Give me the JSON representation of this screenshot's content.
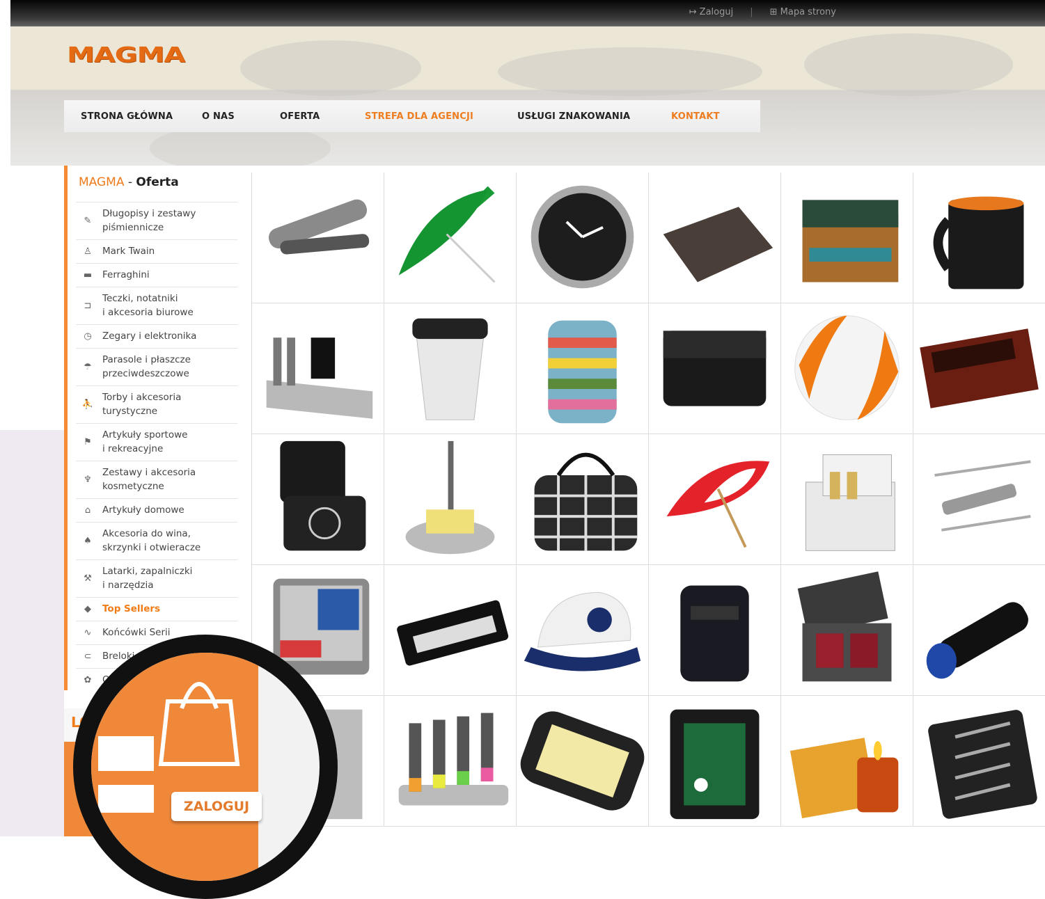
{
  "topbar": {
    "login_label": "Zaloguj",
    "sitemap_label": "Mapa strony"
  },
  "header": {
    "logo_text": "MAGMA"
  },
  "nav": {
    "items": [
      {
        "label": "STRONA GŁÓWNA",
        "active": false
      },
      {
        "label": "O NAS",
        "active": false
      },
      {
        "label": "OFERTA",
        "active": false
      },
      {
        "label": "STREFA DLA AGENCJI",
        "active": true
      },
      {
        "label": "USŁUGI ZNAKOWANIA",
        "active": false
      },
      {
        "label": "KONTAKT",
        "active": true
      }
    ]
  },
  "sidebar": {
    "title_brand": "MAGMA",
    "title_sep": " - ",
    "title_word": "Oferta",
    "items": [
      {
        "line1": "Długopisy i zestawy",
        "line2": "piśmiennicze",
        "icon": "pen-icon"
      },
      {
        "line1": "Mark Twain",
        "line2": "",
        "icon": "bust-icon"
      },
      {
        "line1": "Ferraghini",
        "line2": "",
        "icon": "briefcase-icon"
      },
      {
        "line1": "Teczki, notatniki",
        "line2": "i akcesoria biurowe",
        "icon": "folder-icon"
      },
      {
        "line1": "Zegary i elektronika",
        "line2": "",
        "icon": "clock-icon"
      },
      {
        "line1": "Parasole i płaszcze",
        "line2": "przeciwdeszczowe",
        "icon": "umbrella-icon"
      },
      {
        "line1": "Torby i akcesoria",
        "line2": "turystyczne",
        "icon": "hiker-icon"
      },
      {
        "line1": "Artykuły sportowe",
        "line2": "i rekreacyjne",
        "icon": "sport-icon"
      },
      {
        "line1": "Zestawy i akcesoria",
        "line2": "kosmetyczne",
        "icon": "cosmetics-icon"
      },
      {
        "line1": "Artykuły domowe",
        "line2": "",
        "icon": "home-icon"
      },
      {
        "line1": "Akcesoria do wina,",
        "line2": "skrzynki i otwieracze",
        "icon": "wine-icon"
      },
      {
        "line1": "Latarki, zapalniczki",
        "line2": "i narzędzia",
        "icon": "tools-icon"
      },
      {
        "line1": "Top Sellers",
        "line2": "",
        "icon": "top-sellers-icon",
        "highlight": true
      },
      {
        "line1": "Końcówki Serii",
        "line2": "",
        "icon": "end-of-series-icon"
      },
      {
        "line1": "Breloki",
        "line2": "",
        "icon": "keychain-icon"
      },
      {
        "line1": "O",
        "line2": "",
        "icon": "other-icon"
      }
    ]
  },
  "login_panel": {
    "title": "LO",
    "button_label": "ZALOGUJ"
  },
  "products": [
    [
      "pen-set",
      "green-umbrella",
      "wall-clock",
      "laptop-sleeve",
      "picnic-basket",
      "black-mug"
    ],
    [
      "desk-organizer",
      "travel-tumbler",
      "striped-backpack",
      "messenger-bag",
      "beach-ball",
      "wine-box"
    ],
    [
      "jewelry-box",
      "pen-stand",
      "plaid-bag",
      "red-white-umbrella",
      "gift-box",
      "multi-tool"
    ],
    [
      "trolley-case",
      "pen-case",
      "baseball-cap",
      "backpack",
      "gift-set-box",
      "flashlight"
    ],
    [
      "thermo-mug",
      "highlighters",
      "sticky-notes",
      "golf-set",
      "candle",
      "tool-kit"
    ]
  ],
  "colors": {
    "accent": "#ee7b1b",
    "nav_text": "#222222",
    "grid_line": "#dcdcdc"
  }
}
